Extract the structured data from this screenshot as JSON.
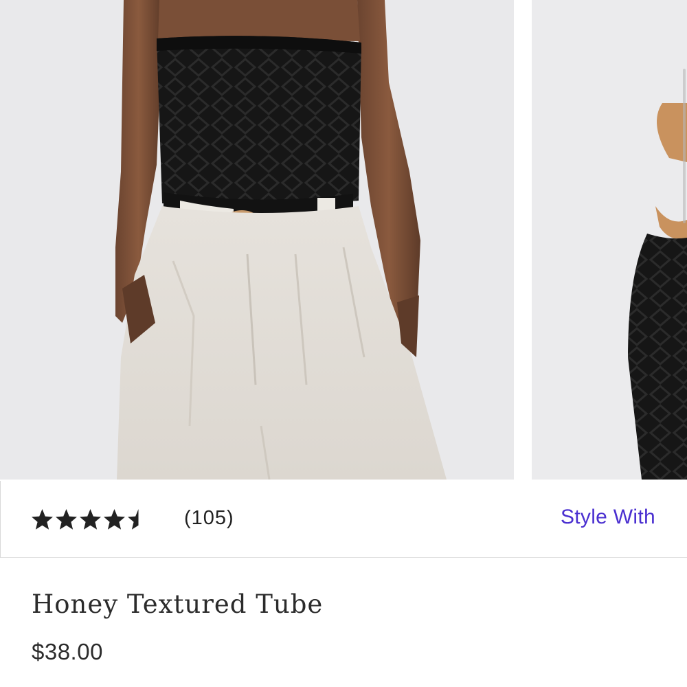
{
  "gallery": {
    "images": [
      {
        "alt_icon": "product-photo-front-icon"
      },
      {
        "alt_icon": "product-photo-side-icon"
      }
    ]
  },
  "rating": {
    "value": 4.5,
    "max": 5,
    "count_label": "(105)"
  },
  "actions": {
    "style_with_label": "Style With"
  },
  "product": {
    "title": "Honey Textured Tube",
    "price": "$38.00"
  },
  "colors": {
    "accent": "#4a2fd0",
    "text": "#2b2b2b",
    "star": "#222222",
    "photo_bg": "#e9e9eb"
  }
}
